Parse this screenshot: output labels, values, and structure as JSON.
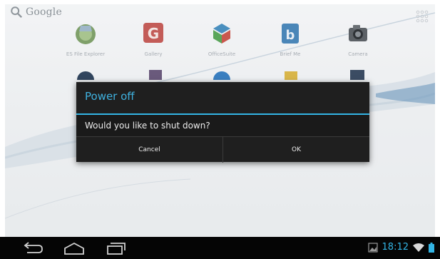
{
  "search": {
    "label": "Google",
    "icon": "search-icon"
  },
  "apps": [
    {
      "name": "ES File Explorer",
      "icon": "es-file-explorer-icon"
    },
    {
      "name": "Gallery",
      "icon": "gallery-g-icon"
    },
    {
      "name": "OfficeSuite",
      "icon": "officesuite-icon"
    },
    {
      "name": "Brief Me",
      "icon": "brief-me-icon"
    },
    {
      "name": "Camera",
      "icon": "camera-icon"
    }
  ],
  "dialog": {
    "title": "Power off",
    "message": "Would you like to shut down?",
    "cancel_label": "Cancel",
    "ok_label": "OK"
  },
  "status_bar": {
    "time": "18:12",
    "accent": "#33b5e5",
    "icons": [
      "gallery-notification-icon",
      "wifi-icon",
      "battery-icon"
    ]
  },
  "nav_bar": {
    "icons": [
      "back-icon",
      "home-icon",
      "recent-apps-icon"
    ]
  },
  "colors": {
    "dialog_bg": "#1f1f1f",
    "accent": "#33b5e5",
    "nav_bg": "#050505"
  }
}
